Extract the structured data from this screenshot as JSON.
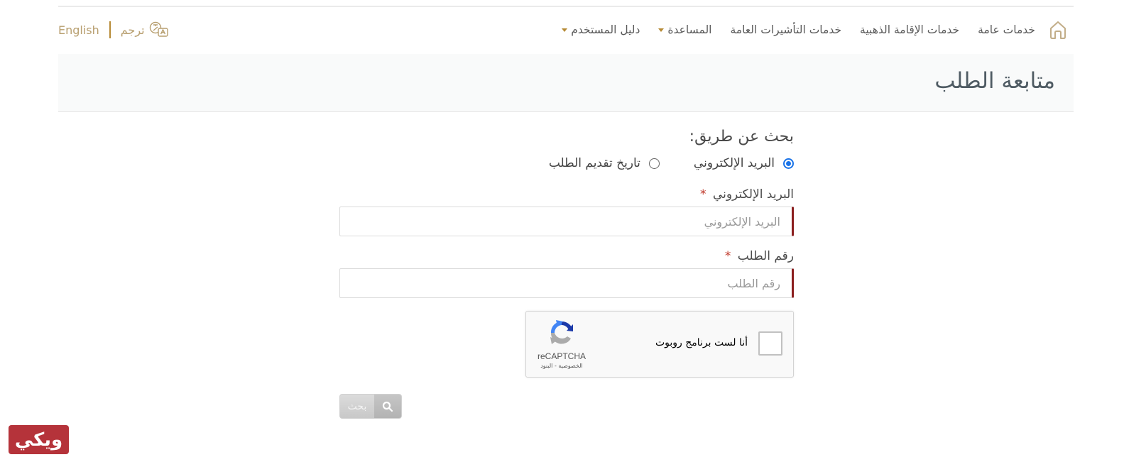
{
  "nav": {
    "items": [
      {
        "label": "خدمات عامة",
        "has_dropdown": false
      },
      {
        "label": "خدمات الإقامة الذهبية",
        "has_dropdown": false
      },
      {
        "label": "خدمات التأشيرات العامة",
        "has_dropdown": false
      },
      {
        "label": "المساعدة",
        "has_dropdown": true
      },
      {
        "label": "دليل المستخدم",
        "has_dropdown": true
      }
    ],
    "translate_label": "ترجم",
    "english_label": "English",
    "home_icon": "home-icon",
    "translate_icon": "translate-icon"
  },
  "header": {
    "title": "متابعة الطلب"
  },
  "form": {
    "search_by_label": "بحث عن طريق:",
    "radio_options": [
      {
        "label": "البريد الإلكتروني",
        "checked": true
      },
      {
        "label": "تاريخ تقديم الطلب",
        "checked": false
      }
    ],
    "email_label": "البريد الإلكتروني",
    "email_required": "*",
    "email_placeholder": "البريد الإلكتروني",
    "email_value": "",
    "request_label": "رقم الطلب",
    "request_required": "*",
    "request_placeholder": "رقم الطلب",
    "request_value": "",
    "captcha": {
      "text": "أنا لست برنامج روبوت",
      "brand": "reCAPTCHA",
      "links": "الخصوصية - البنود",
      "checked": false
    },
    "search_button_label": "بحث",
    "search_icon": "search-icon"
  },
  "watermark": {
    "text": "ويكي"
  },
  "colors": {
    "accent_gold": "#b68a35",
    "required_red": "#8b1e1e",
    "radio_blue": "#1a73e8",
    "watermark_red": "#b5333a"
  }
}
